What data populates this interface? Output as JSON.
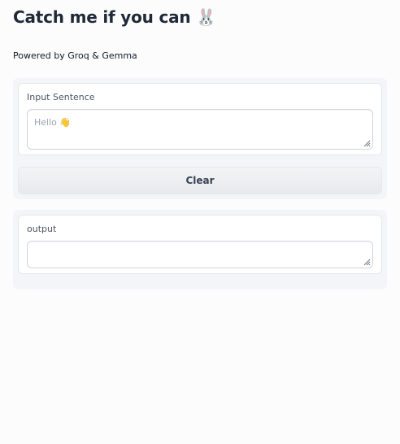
{
  "header": {
    "title": "Catch me if you can 🐰",
    "subtitle": "Powered by Groq & Gemma"
  },
  "input": {
    "label": "Input Sentence",
    "placeholder": "Hello 👋"
  },
  "actions": {
    "clear_label": "Clear"
  },
  "output": {
    "label": "output",
    "value": ""
  }
}
